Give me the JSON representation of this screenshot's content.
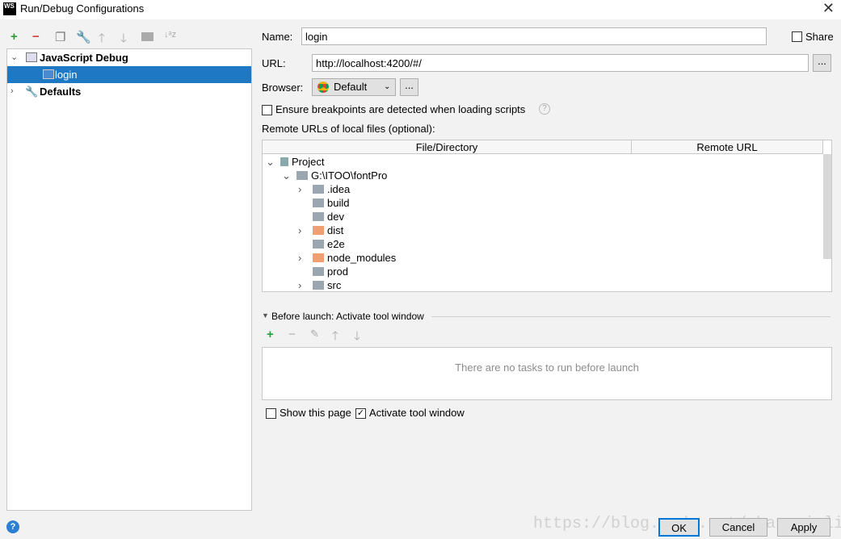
{
  "window": {
    "title": "Run/Debug Configurations",
    "logo": "WS"
  },
  "toolbar": {
    "icons": [
      "add-icon",
      "remove-icon",
      "copy-icon",
      "wrench-icon",
      "arrow-up-icon",
      "arrow-down-icon",
      "folder-icon",
      "sort-az-icon"
    ]
  },
  "tree": {
    "items": [
      {
        "label": "JavaScript Debug"
      },
      {
        "label": "login"
      },
      {
        "label": "Defaults"
      }
    ]
  },
  "form": {
    "name_label": "Name:",
    "name_value": "login",
    "share_label": "Share",
    "url_label": "URL:",
    "url_value": "http://localhost:4200/#/",
    "browser_label": "Browser:",
    "browser_value": "Default",
    "ellipsis": "...",
    "ensure_label": "Ensure breakpoints are detected when loading scripts",
    "remote_label": "Remote URLs of local files (optional):"
  },
  "table": {
    "headers": [
      "File/Directory",
      "Remote URL"
    ],
    "rows": [
      {
        "label": "Project",
        "indent": 0,
        "chev": "v",
        "type": "project"
      },
      {
        "label": "G:\\ITOO\\fontPro",
        "indent": 1,
        "chev": "v",
        "type": "folder"
      },
      {
        "label": ".idea",
        "indent": 2,
        "chev": ">",
        "type": "folder"
      },
      {
        "label": "build",
        "indent": 2,
        "chev": "",
        "type": "folder"
      },
      {
        "label": "dev",
        "indent": 2,
        "chev": "",
        "type": "folder"
      },
      {
        "label": "dist",
        "indent": 2,
        "chev": ">",
        "type": "excluded"
      },
      {
        "label": "e2e",
        "indent": 2,
        "chev": "",
        "type": "folder"
      },
      {
        "label": "node_modules",
        "indent": 2,
        "chev": ">",
        "type": "excluded"
      },
      {
        "label": "prod",
        "indent": 2,
        "chev": "",
        "type": "folder"
      },
      {
        "label": "src",
        "indent": 2,
        "chev": ">",
        "type": "folder"
      }
    ]
  },
  "before_launch": {
    "title": "Before launch: Activate tool window",
    "empty": "There are no tasks to run before launch",
    "show_page": "Show this page",
    "show_page_checked": false,
    "activate": "Activate tool window",
    "activate_checked": true
  },
  "buttons": {
    "ok": "OK",
    "cancel": "Cancel",
    "apply": "Apply",
    "help": "?"
  },
  "watermark": "https://blog.csdn.net/changyinling520"
}
